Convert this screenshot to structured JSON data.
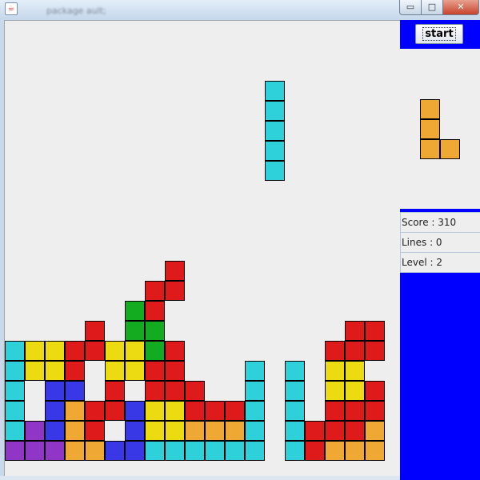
{
  "window": {
    "app_icon": "java-cup-icon",
    "blurred_title": "package ault;",
    "minimize_glyph": "▭",
    "maximize_glyph": "□",
    "close_glyph": "✕"
  },
  "controls": {
    "start_label": "start"
  },
  "stats": {
    "score": "Score : 310",
    "lines": "Lines : 0",
    "level": "Level : 2"
  },
  "colors": {
    "cyan": "#2ed0d9",
    "yellow": "#eddb12",
    "red": "#de1a1a",
    "blue": "#3838e6",
    "orange": "#f0a835",
    "green": "#13ab1f",
    "purple": "#8f36c6",
    "board_bg": "#eeeeee",
    "panel_blue": "#0000ff"
  },
  "palette_keys": {
    "C": "cyan",
    "Y": "yellow",
    "R": "red",
    "B": "blue",
    "O": "orange",
    "G": "green",
    "P": "purple"
  },
  "board": {
    "rows": [
      "...................",
      "...................",
      "...................",
      "...................",
      "...................",
      "...................",
      "...................",
      "...................",
      "...................",
      "...................",
      "...................",
      "...................",
      "........R..........",
      ".......RR..........",
      "......GR...........",
      "....R.GG.........RR",
      "CYYRRYYGR.......RRR",
      "CYYR.YYRR...C.C.YY.",
      "C.BB.R.RRR..C.C.YYR",
      "C.BORRBYYRRRC.C.RRR",
      "CPBOR.BYYOOOC.CRRRO",
      "PPPOOBBCCCCCC.CROOO"
    ]
  },
  "falling_piece": {
    "color": "C",
    "column": 13,
    "rows": [
      3,
      4,
      5,
      6,
      7
    ]
  },
  "next_piece": {
    "color": "O",
    "rows": [
      "X.",
      "X.",
      "XX"
    ]
  }
}
